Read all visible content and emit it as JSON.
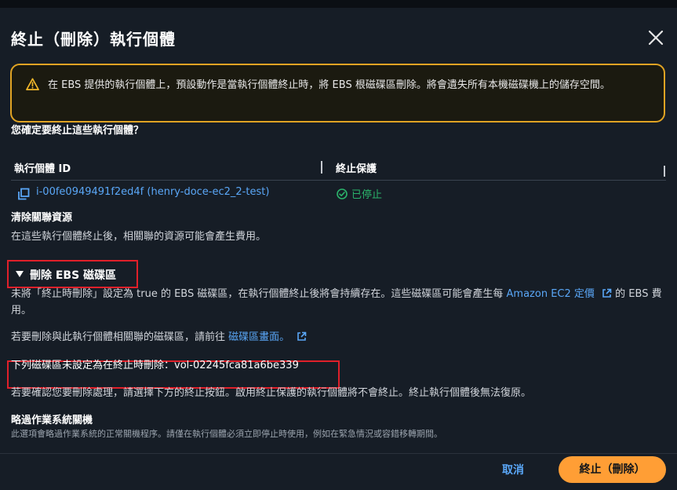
{
  "dialog": {
    "title": "終止（刪除）執行個體"
  },
  "warning": {
    "text": "在 EBS 提供的執行個體上，預設動作是當執行個體終止時，將 EBS 根磁碟區刪除。將會遺失所有本機磁碟機上的儲存空間。"
  },
  "confirm_question": "您確定要終止這些執行個體？",
  "table": {
    "columns": [
      "執行個體 ID",
      "終止保護"
    ],
    "rows": [
      {
        "instance_id": "i-00fe0949491f2ed4f (henry-doce-ec2_2-test)",
        "protection": "已停止"
      }
    ]
  },
  "cleanup": {
    "heading": "清除關聯資源",
    "description": "在這些執行個體終止後，相關聯的資源可能會產生費用。"
  },
  "ebs_section": {
    "expander_label": "刪除 EBS 磁碟區",
    "paragraph_prefix": "未將「終止時刪除」設定為 true 的 EBS 磁碟區，在執行個體終止後將會持續存在。這些磁碟區可能會產生每",
    "pricing_link": "Amazon EC2 定價",
    "paragraph_suffix": "的 EBS 費用。",
    "goto_prefix": "若要刪除與此執行個體相關聯的磁碟區，請前往",
    "volumes_link": "磁碟區畫面。",
    "not_set_label": "下列磁碟區未設定為在終止時刪除：",
    "volume_id": "vol-02245fca81a6be339"
  },
  "confirm_note": "若要確認您要刪除處理，請選擇下方的終止按鈕。啟用終止保護的執行個體將不會終止。終止執行個體後無法復原。",
  "bypass": {
    "heading": "略過作業系統關機",
    "description": "此選項會略過作業系統的正常關機程序。請僅在執行個體必須立即停止時使用，例如在緊急情況或容錯移轉期間。"
  },
  "footer": {
    "cancel_label": "取消",
    "terminate_label": "終止（刪除）"
  },
  "colors": {
    "accent": "#ff9e35",
    "link": "#5aa7f7",
    "warning_border": "#e0a323",
    "success": "#2bb36b",
    "highlight_box": "#e0202a"
  }
}
